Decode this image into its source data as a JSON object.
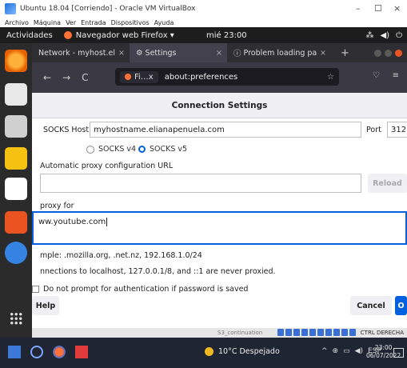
{
  "vbox": {
    "title": "Ubuntu 18.04 [Corriendo] - Oracle VM VirtualBox",
    "menu": [
      "Archivo",
      "Máquina",
      "Ver",
      "Entrada",
      "Dispositivos",
      "Ayuda"
    ],
    "status_strip_text": "S3_continuation",
    "host_key": "CTRL DERECHA"
  },
  "gnome": {
    "activities": "Actividades",
    "app_name": "Navegador web Firefox ▾",
    "clock": "mié 23:00"
  },
  "firefox": {
    "tabs": [
      {
        "label": "Network - myhost.el",
        "close": "×"
      },
      {
        "label": "Settings",
        "close": "×"
      },
      {
        "label": "Problem loading pa",
        "close": "×"
      }
    ],
    "new_tab": "+",
    "identity_chip": "Fi…x",
    "url": "about:preferences"
  },
  "dialog": {
    "title": "Connection Settings",
    "socks_host_label": "SOCKS Host",
    "socks_host_value": "myhostname.elianapenuela.com",
    "port_label": "Port",
    "port_value": "312",
    "socks_v4": "SOCKS v4",
    "socks_v5": "SOCKS v5",
    "auto_proxy_label": "Automatic proxy configuration URL",
    "auto_proxy_value": "",
    "reload_button": "Reload",
    "no_proxy_label": "proxy for",
    "no_proxy_value": "ww.youtube.com",
    "example_text": "mple: .mozilla.org, .net.nz, 192.168.1.0/24",
    "localhost_text": "nnections to localhost, 127.0.0.1/8, and ::1 are never proxied.",
    "no_prompt_label": "Do not prompt for authentication if password is saved",
    "help_button": "Help",
    "cancel_button": "Cancel",
    "ok_button": "O"
  },
  "taskbar": {
    "weather": "10°C Despejado",
    "lang": "ESP",
    "time": "23:00",
    "date": "06/07/2022"
  }
}
